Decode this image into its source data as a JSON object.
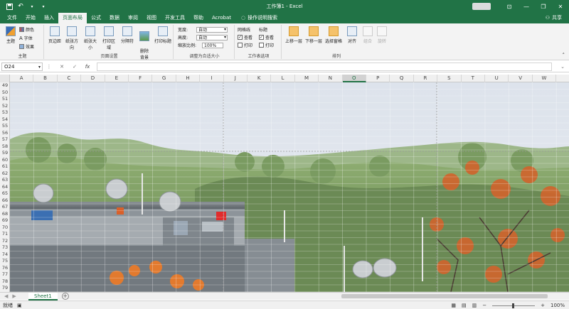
{
  "window": {
    "title": "工作簿1 - Excel",
    "controls": {
      "ribbon_display": "⊡",
      "minimize": "—",
      "restore": "❐",
      "close": "✕"
    }
  },
  "quick_access": {
    "save_icon": "save-icon",
    "undo_icon": "undo-icon",
    "redo_icon": "redo-icon",
    "customize_icon": "customize-icon"
  },
  "tabs": [
    "文件",
    "开始",
    "插入",
    "页面布局",
    "公式",
    "数据",
    "审阅",
    "视图",
    "开发工具",
    "帮助",
    "Acrobat"
  ],
  "active_tab": "页面布局",
  "tell_me": "操作说明搜索",
  "share": "共享",
  "ribbon": {
    "themes": {
      "big": "主题",
      "colors": "颜色",
      "fonts": "字体",
      "effects": "效果",
      "label": "主题"
    },
    "page_setup": {
      "buttons": [
        "页边距",
        "纸张方向",
        "纸张大小",
        "打印区域",
        "分隔符",
        "删除\n背景",
        "打印标题"
      ],
      "label": "页面设置"
    },
    "scale": {
      "width_label": "宽度:",
      "width_value": "自动",
      "height_label": "高度:",
      "height_value": "自动",
      "scale_label": "缩放比例:",
      "scale_value": "100%",
      "label": "调整为合适大小"
    },
    "sheet_options": {
      "gridlines": "网格线",
      "headings": "标题",
      "view": "查看",
      "print": "打印",
      "label": "工作表选项"
    },
    "arrange": {
      "buttons": [
        "上移一层",
        "下移一层",
        "选择窗格",
        "对齐",
        "组合",
        "旋转"
      ],
      "label": "排列"
    }
  },
  "formula_bar": {
    "name_box": "O24",
    "cancel": "✕",
    "enter": "✓",
    "fx": "fx",
    "value": ""
  },
  "columns": [
    "A",
    "B",
    "C",
    "D",
    "E",
    "F",
    "G",
    "H",
    "I",
    "J",
    "K",
    "L",
    "M",
    "N",
    "O",
    "P",
    "Q",
    "R",
    "S",
    "T",
    "U",
    "V",
    "W"
  ],
  "selected_column": "O",
  "rows": [
    "49",
    "50",
    "51",
    "52",
    "53",
    "54",
    "55",
    "56",
    "57",
    "58",
    "59",
    "60",
    "61",
    "62",
    "63",
    "64",
    "65",
    "66",
    "67",
    "68",
    "69",
    "70",
    "71",
    "72",
    "73",
    "74",
    "75",
    "76",
    "77",
    "78",
    "79"
  ],
  "sheet_tabs": [
    "Sheet1"
  ],
  "add_sheet": "+",
  "status": {
    "ready": "就绪",
    "zoom": "100%",
    "zoom_minus": "−",
    "zoom_plus": "+"
  }
}
